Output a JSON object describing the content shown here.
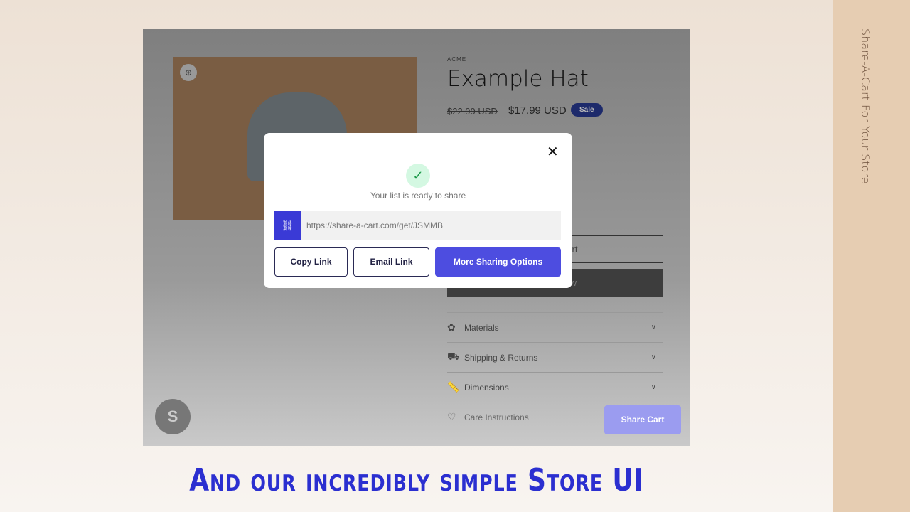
{
  "side_label": "Share-A-Cart For Your Store",
  "headline": "And our incredibly simple Store UI",
  "product": {
    "brand": "ACME",
    "title": "Example Hat",
    "old_price": "$22.99 USD",
    "price": "$17.99 USD",
    "badge": "Sale",
    "add_to_cart": "Add to cart",
    "buy_now": "Buy it now"
  },
  "accordion": [
    {
      "label": "Materials",
      "icon": "leather-icon"
    },
    {
      "label": "Shipping & Returns",
      "icon": "truck-icon"
    },
    {
      "label": "Dimensions",
      "icon": "ruler-icon"
    },
    {
      "label": "Care Instructions",
      "icon": "heart-icon"
    }
  ],
  "share_cart": "Share Cart",
  "modal": {
    "message": "Your list is ready to share",
    "url": "https://share-a-cart.com/get/JSMMB",
    "copy": "Copy Link",
    "email": "Email Link",
    "more": "More Sharing Options"
  },
  "colors": {
    "accent": "#4d4de0",
    "headline": "#2b2fd0",
    "success": "#1e9b4b"
  }
}
